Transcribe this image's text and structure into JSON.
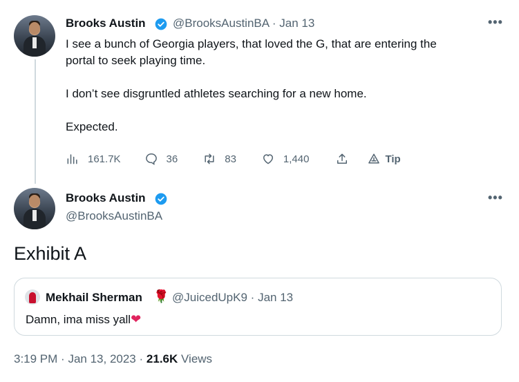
{
  "tweet1": {
    "name": "Brooks Austin",
    "handle": "@BrooksAustinBA",
    "separator": "·",
    "date": "Jan 13",
    "more": "•••",
    "text_lines": [
      "I see a bunch of Georgia players, that loved the G, that are entering the",
      "portal to seek playing time.",
      "I don’t see disgruntled athletes searching for a new home.",
      "Expected."
    ],
    "actions": {
      "views": "161.7K",
      "replies": "36",
      "retweets": "83",
      "likes": "1,440",
      "tip": "Tip"
    }
  },
  "tweet2": {
    "name": "Brooks Austin",
    "handle": "@BrooksAustinBA",
    "more": "•••",
    "text": "Exhibit A",
    "quote": {
      "name": "Mekhail Sherman",
      "emoji": "🌹",
      "handle": "@JuicedUpK9",
      "separator": "·",
      "date": "Jan 13",
      "text": "Damn, ima miss yall",
      "heart": "❤"
    },
    "meta": {
      "time": "3:19 PM",
      "separator": "·",
      "date": "Jan 13, 2023",
      "separator2": "·",
      "views_count": "21.6K",
      "views_label": "Views"
    }
  },
  "colors": {
    "accent": "#1d9bf0",
    "secondary_text": "#536471",
    "primary_text": "#0f1419",
    "border": "#cfd9de"
  }
}
